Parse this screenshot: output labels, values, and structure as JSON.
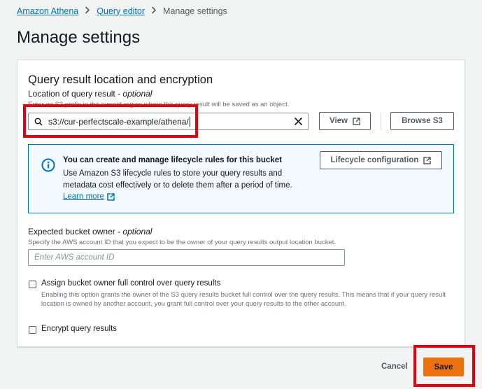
{
  "breadcrumb": {
    "items": [
      "Amazon Athena",
      "Query editor"
    ],
    "current": "Manage settings"
  },
  "page_title": "Manage settings",
  "query_result": {
    "section_title": "Query result location and encryption",
    "location_label": "Location of query result",
    "location_optional": "optional",
    "location_description": "Enter an S3 prefix in the current region where the query result will be saved as an object.",
    "location_value": "s3://cur-perfectscale-example/athena/",
    "view_button": "View",
    "browse_button": "Browse S3"
  },
  "info_box": {
    "title": "You can create and manage lifecycle rules for this bucket",
    "body": "Use Amazon S3 lifecycle rules to store your query results and metadata cost effectively or to delete them after a period of time.",
    "learn_more": "Learn more",
    "lifecycle_button": "Lifecycle configuration"
  },
  "bucket_owner": {
    "label": "Expected bucket owner",
    "optional": "optional",
    "description": "Specify the AWS account ID that you expect to be the owner of your query results output location bucket.",
    "placeholder": "Enter AWS account ID"
  },
  "full_control": {
    "label": "Assign bucket owner full control over query results",
    "description": "Enabling this option grants the owner of the S3 query results bucket full control over the query results. This means that if your query result location is owned by another account, you grant full control over your query results to the other account.",
    "checked": false
  },
  "encrypt": {
    "label": "Encrypt query results",
    "checked": false
  },
  "footer": {
    "cancel": "Cancel",
    "save": "Save"
  },
  "colors": {
    "link": "#0073bb",
    "primary": "#ec7211",
    "info_bg": "#f1faff",
    "highlight": "#e6000f"
  }
}
